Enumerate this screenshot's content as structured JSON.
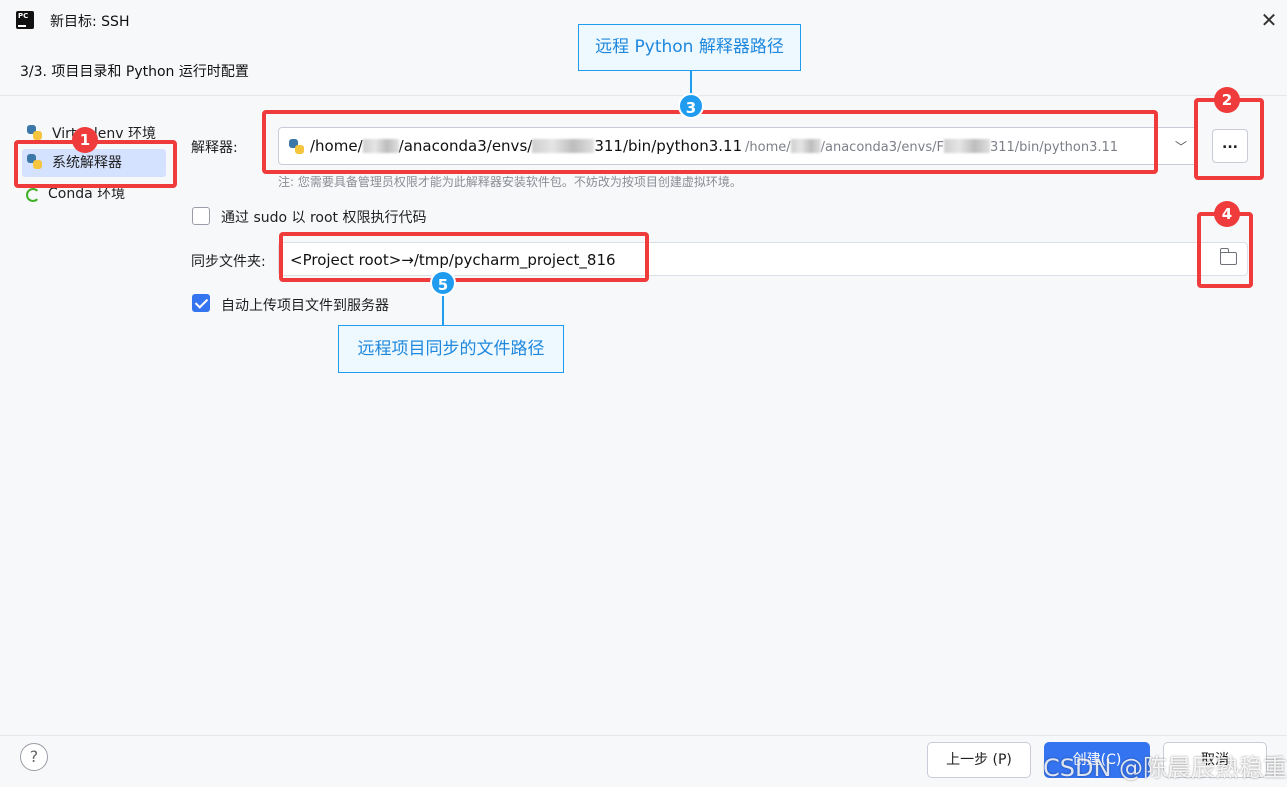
{
  "window": {
    "title": "新目标: SSH",
    "close_symbol": "✕"
  },
  "step_header": "3/3. 项目目录和 Python 运行时配置",
  "sidebar": {
    "items": [
      {
        "label": "Virtualenv 环境",
        "icon": "python-icon",
        "selected": false
      },
      {
        "label": "系统解释器",
        "icon": "python-icon",
        "selected": true
      },
      {
        "label": "Conda 环境",
        "icon": "conda-icon",
        "selected": false
      }
    ]
  },
  "interpreter": {
    "label": "解释器:",
    "path_parts": [
      "/home/",
      "/anaconda3/envs/",
      "311/bin/python3.11"
    ],
    "secondary_parts": [
      "/home/",
      "/anaconda3/envs/F",
      "311/bin/python3.11"
    ],
    "browse_label": "..."
  },
  "note": "注: 您需要具备管理员权限才能为此解释器安装软件包。不妨改为按项目创建虚拟环境。",
  "sudo": {
    "label": "通过 sudo 以 root 权限执行代码",
    "checked": false
  },
  "sync": {
    "label": "同步文件夹:",
    "value": "<Project root>→/tmp/pycharm_project_816"
  },
  "upload": {
    "label": "自动上传项目文件到服务器",
    "checked": true
  },
  "footer": {
    "help": "?",
    "prev_label": "上一步 (P)",
    "create_label": "创建(C)",
    "cancel_label": "取消"
  },
  "watermark": "CSDN @陈晨辰熟稳重",
  "annotations": {
    "badges": [
      "1",
      "2",
      "3",
      "4",
      "5"
    ],
    "callout_python_path": "远程 Python 解释器路径",
    "callout_sync_path": "远程项目同步的文件路径"
  },
  "colors": {
    "accent": "#3574f0",
    "annotation_red": "#ef3b3b",
    "annotation_blue": "#1f9cf0"
  }
}
